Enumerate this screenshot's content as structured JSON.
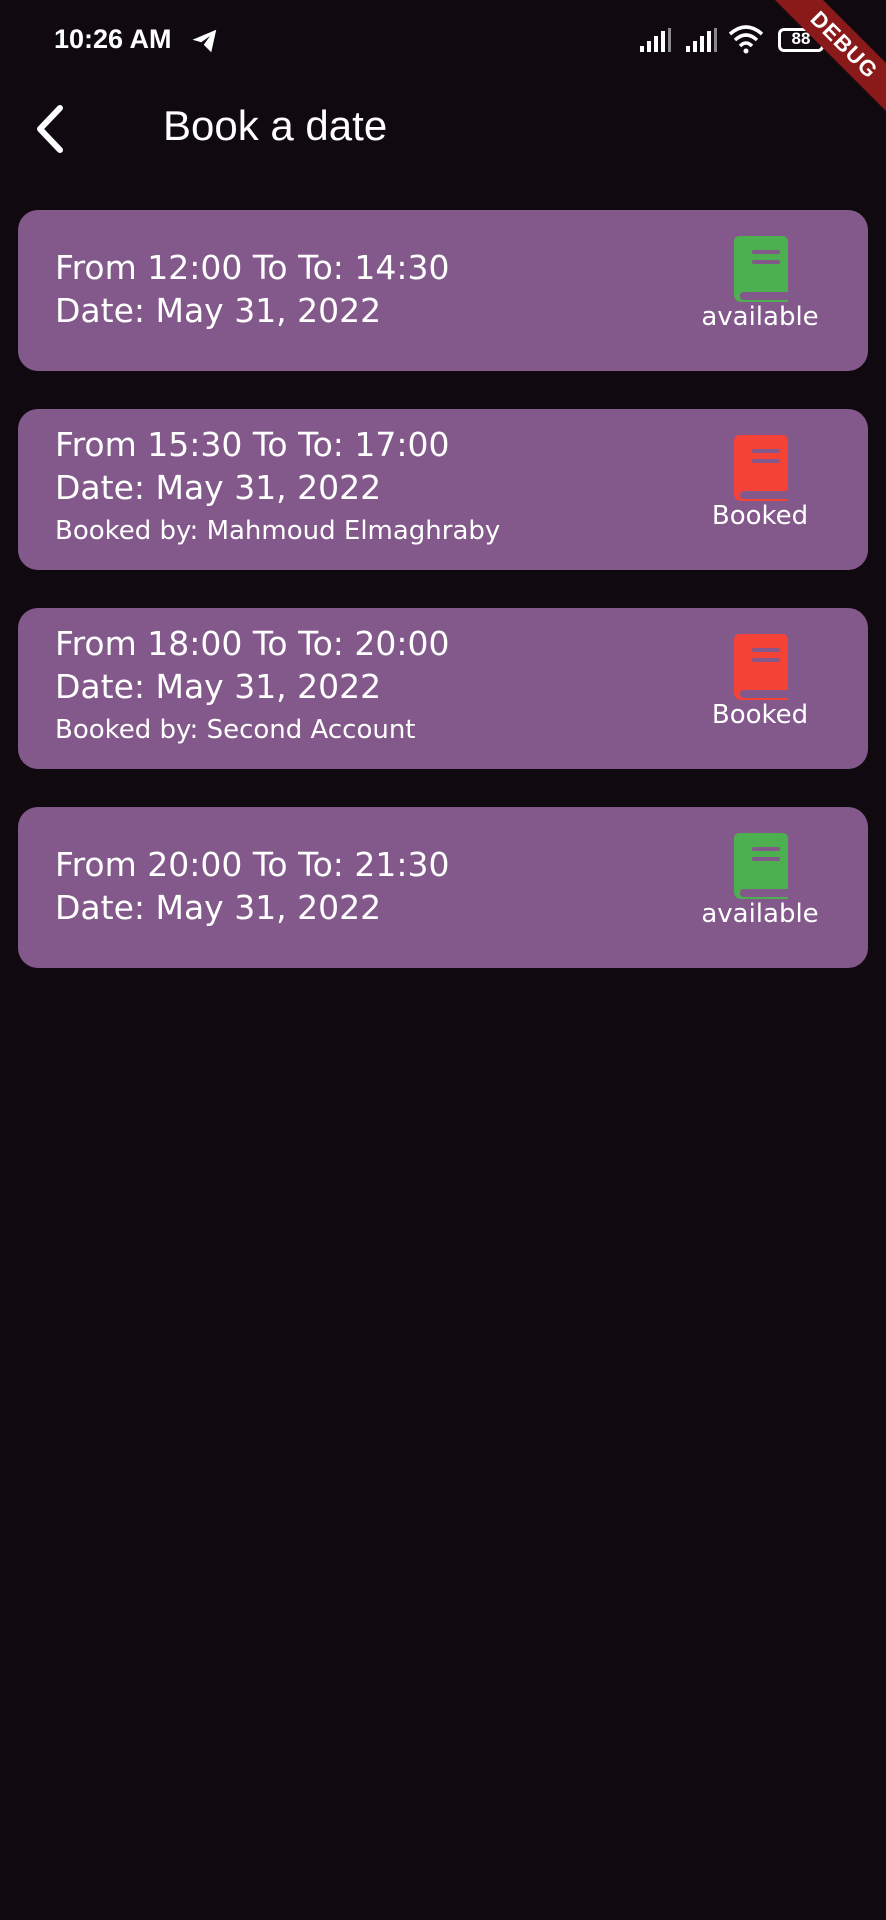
{
  "status_bar": {
    "time": "10:26 AM",
    "battery": "88",
    "icons": [
      "telegram-icon",
      "signal-icon",
      "signal-icon",
      "wifi-icon",
      "battery-icon"
    ]
  },
  "debug_banner": "DEBUG",
  "header": {
    "title": "Book a date",
    "back_icon": "back-arrow-icon"
  },
  "colors": {
    "background": "#100a10",
    "card": "#83598b",
    "available": "#4caf50",
    "booked": "#f44336"
  },
  "slots": [
    {
      "time": "From 12:00 To To: 14:30",
      "date": "Date: May 31, 2022",
      "booked_by": "",
      "status": "available",
      "icon": "book-icon"
    },
    {
      "time": "From 15:30 To To: 17:00",
      "date": "Date: May 31, 2022",
      "booked_by": "Booked by: Mahmoud Elmaghraby",
      "status": "Booked",
      "icon": "book-icon"
    },
    {
      "time": "From 18:00 To To: 20:00",
      "date": "Date: May 31, 2022",
      "booked_by": "Booked by: Second Account",
      "status": "Booked",
      "icon": "book-icon"
    },
    {
      "time": "From 20:00 To To: 21:30",
      "date": "Date: May 31, 2022",
      "booked_by": "",
      "status": "available",
      "icon": "book-icon"
    }
  ]
}
